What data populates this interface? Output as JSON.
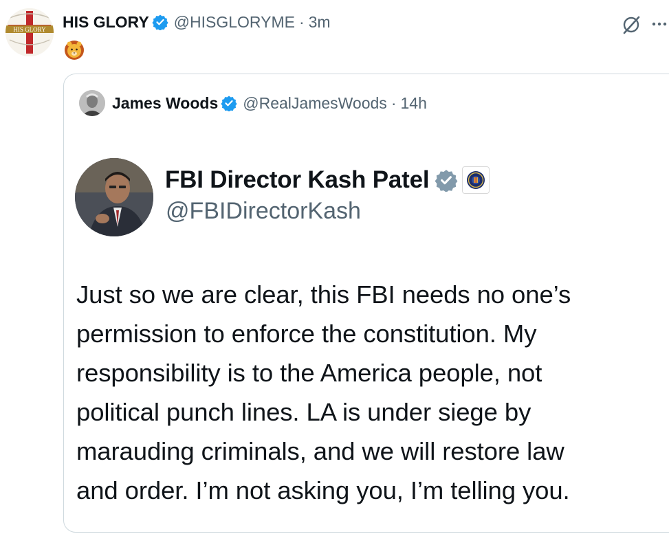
{
  "post": {
    "author_name": "HIS GLORY",
    "handle": "@HISGLORYME",
    "separator": "·",
    "time": "3m",
    "avatar_text": "HIS GLORY",
    "emoji": "lion-face",
    "verified_color": "#1d9bf0"
  },
  "quote": {
    "author_name": "James Woods",
    "handle": "@RealJamesWoods",
    "separator": "·",
    "time": "14h"
  },
  "embedded_image": {
    "name": "FBI Director Kash Patel",
    "handle": "@FBIDirectorKash",
    "verified_color": "#829aab",
    "text_lines": [
      "Just so we are clear, this FBI needs no one’s",
      "permission to enforce the constitution. My",
      "responsibility is to the America people, not",
      "political punch lines. LA is under siege by",
      "marauding criminals, and we will restore law",
      "and order. I’m not asking you, I’m telling you."
    ]
  },
  "icons": {
    "grok": "grok-icon",
    "more": "more-icon"
  }
}
